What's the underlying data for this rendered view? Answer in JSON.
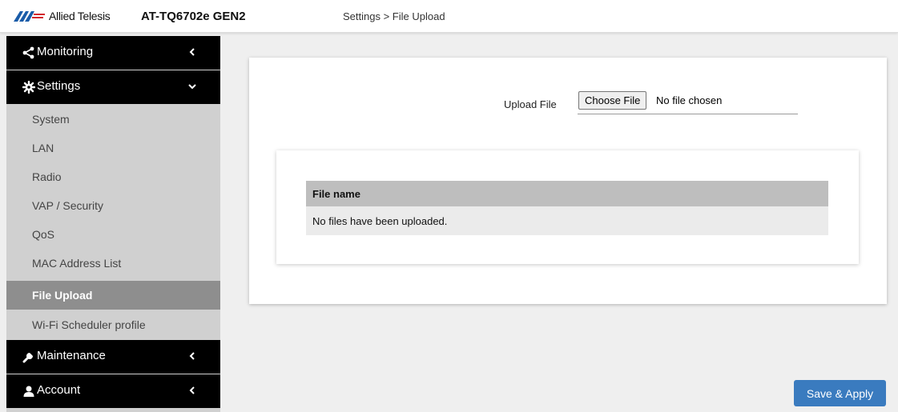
{
  "header": {
    "brand": "Allied Telesis",
    "model": "AT-TQ6702e GEN2",
    "breadcrumb": "Settings > File Upload"
  },
  "sidebar": {
    "groups": [
      {
        "label": "Monitoring",
        "icon": "share-icon",
        "expanded": false
      },
      {
        "label": "Settings",
        "icon": "gear-icon",
        "expanded": true
      },
      {
        "label": "Maintenance",
        "icon": "wrench-icon",
        "expanded": false
      },
      {
        "label": "Account",
        "icon": "user-icon",
        "expanded": false
      }
    ],
    "settings_items": [
      {
        "label": "System"
      },
      {
        "label": "LAN"
      },
      {
        "label": "Radio"
      },
      {
        "label": "VAP / Security"
      },
      {
        "label": "QoS"
      },
      {
        "label": "MAC Address List"
      },
      {
        "label": "File Upload",
        "active": true
      },
      {
        "label": "Wi-Fi Scheduler profile"
      }
    ]
  },
  "upload": {
    "label": "Upload File",
    "button_label": "Choose File",
    "status": "No file chosen"
  },
  "table": {
    "column_header": "File name",
    "empty_message": "No files have been uploaded."
  },
  "actions": {
    "save_apply_label": "Save & Apply"
  },
  "colors": {
    "accent": "#3a7bbf",
    "logo_blue": "#1a5ca8",
    "logo_red": "#d4232b",
    "nav_group_bg": "#000000",
    "active_item_bg": "#8e8e8e"
  }
}
